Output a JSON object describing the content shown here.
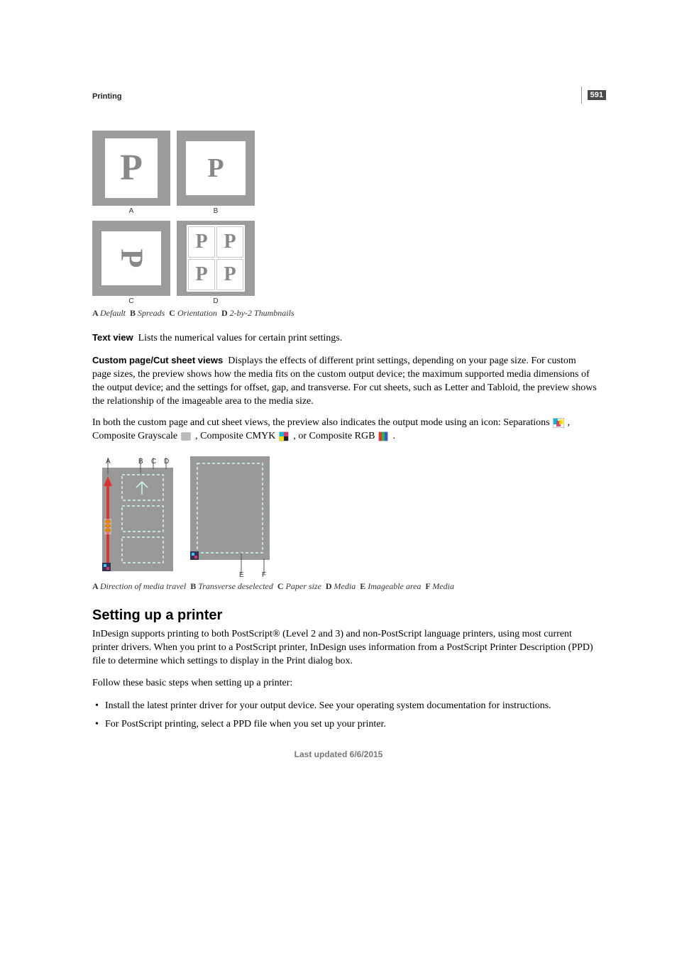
{
  "page_number": "591",
  "section_header": "Printing",
  "fig1": {
    "labels": {
      "A": "A",
      "B": "B",
      "C": "C",
      "D": "D"
    },
    "caption_prefix": "A ",
    "caption": {
      "A": "Default",
      "B": "Spreads",
      "C": "Orientation",
      "D": "2-by-2 Thumbnails"
    }
  },
  "text_view": {
    "label": "Text view",
    "body": "Lists the numerical values for certain print settings."
  },
  "custom_view": {
    "label": "Custom page/Cut sheet views",
    "body": "Displays the effects of different print settings, depending on your page size. For custom page sizes, the preview shows how the media fits on the custom output device; the maximum supported media dimensions of the output device; and the settings for offset, gap, and transverse. For cut sheets, such as Letter and Tabloid, the preview shows the relationship of the imageable area to the media size."
  },
  "modes_para": {
    "lead": "In both the custom page and cut sheet views, the preview also indicates the output mode using an icon: Separations ",
    "gray": ", Composite Grayscale ",
    "cmyk": ", Composite CMYK ",
    "rgb": ", or Composite RGB ",
    "end": "."
  },
  "fig2_caption": {
    "A": "Direction of media travel",
    "B": "Transverse deselected",
    "C": "Paper size",
    "D": "Media",
    "E": "Imageable area",
    "F": "Media"
  },
  "setting_up": {
    "heading": "Setting up a printer",
    "p1": "InDesign supports printing to both PostScript® (Level 2 and 3) and non-PostScript language printers, using most current printer drivers. When you print to a PostScript printer, InDesign uses information from a PostScript Printer Description (PPD) file to determine which settings to display in the Print dialog box.",
    "p2": "Follow these basic steps when setting up a printer:",
    "bullets": [
      "Install the latest printer driver for your output device. See your operating system documentation for instructions.",
      "For PostScript printing, select a PPD file when you set up your printer."
    ]
  },
  "footer": "Last updated 6/6/2015"
}
